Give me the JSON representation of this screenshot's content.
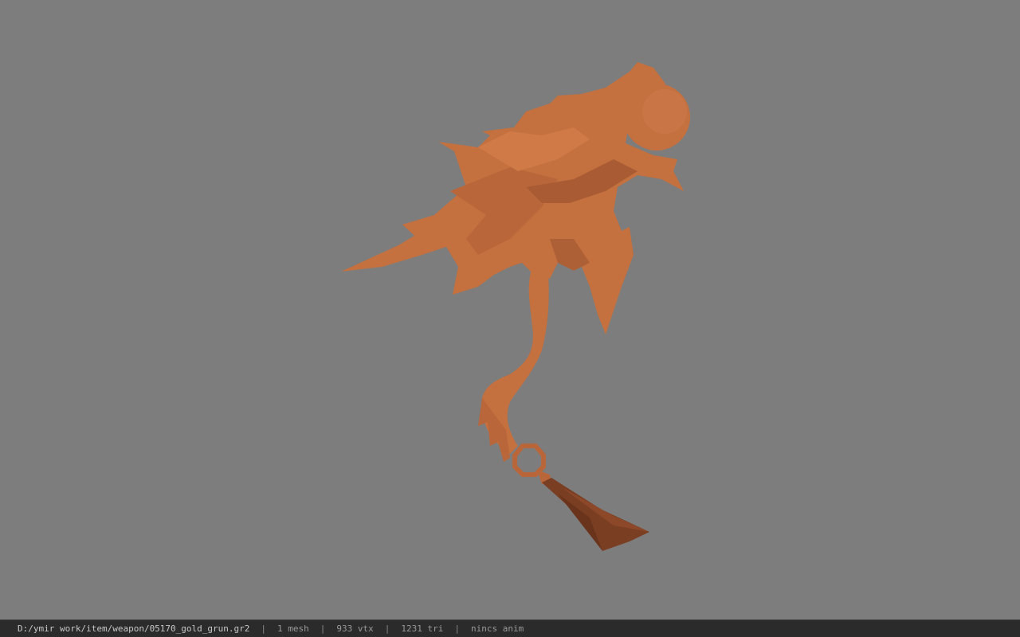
{
  "viewport": {
    "background": "#7d7d7d",
    "model_color": "#c4703f",
    "model_shadow": "#9b5431",
    "tassel_color": "#7a3e22"
  },
  "status": {
    "file_path": "D:/ymir work/item/weapon/05170_gold_grun.gr2",
    "separator": "|",
    "mesh": "1 mesh",
    "vertices": "933 vtx",
    "triangles": "1231 tri",
    "anim": "nincs anim"
  }
}
